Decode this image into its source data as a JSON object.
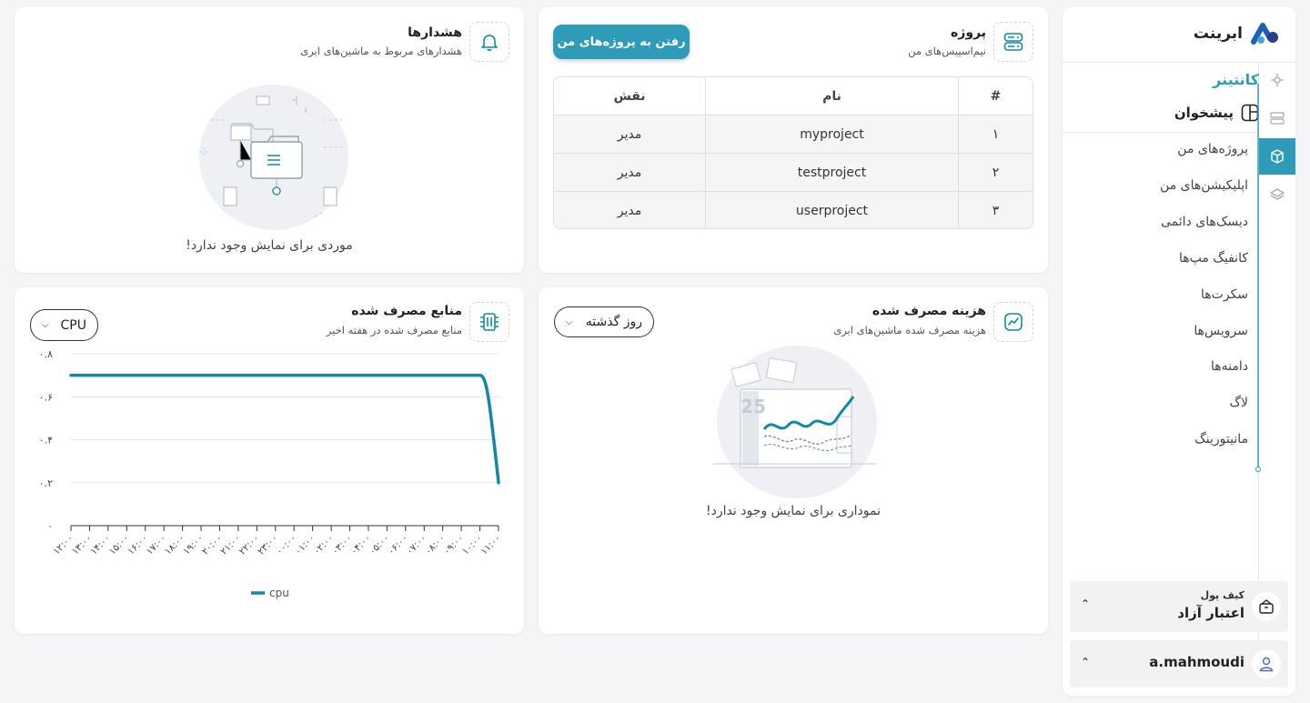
{
  "brand": {
    "name": "ابرینت"
  },
  "sidebar": {
    "section_title": "کانتینر",
    "dashboard_label": "پیشخوان",
    "items": [
      {
        "label": "پروژه‌های من"
      },
      {
        "label": "اپلیکیشن‌های من"
      },
      {
        "label": "دیسک‌های دائمی"
      },
      {
        "label": "کانفیگ مپ‌ها"
      },
      {
        "label": "سکرت‌ها"
      },
      {
        "label": "سرویس‌ها"
      },
      {
        "label": "دامنه‌ها"
      },
      {
        "label": "لاگ"
      },
      {
        "label": "مانیتورینگ"
      }
    ],
    "wallet": {
      "title": "کیف پول",
      "value": "اعتبار آزاد"
    },
    "user": {
      "name": "a.mahmoudi"
    },
    "accent": "#2e9bb8"
  },
  "projects": {
    "title": "پروژه",
    "subtitle": "نیم‌اسپیس‌های من",
    "button_label": "رفتن به پروژه‌های من",
    "columns": [
      "#",
      "نام",
      "نقش"
    ],
    "rows": [
      {
        "num": "۱",
        "name": "myproject",
        "role": "مدیر"
      },
      {
        "num": "۲",
        "name": "testproject",
        "role": "مدیر"
      },
      {
        "num": "۳",
        "name": "userproject",
        "role": "مدیر"
      }
    ]
  },
  "alerts": {
    "title": "هشدارها",
    "subtitle": "هشدارهای مربوط به ماشین‌های ابری",
    "empty_text": "موردی برای نمایش وجود ندارد!"
  },
  "cost": {
    "title": "هزینه مصرف شده",
    "subtitle": "هزینه مصرف شده ماشین‌های ابری",
    "dropdown": "روز گذشته",
    "illustration_number": "25",
    "empty_text": "نموداری برای نمایش وجود ندارد!"
  },
  "resources": {
    "title": "منابع مصرف شده",
    "subtitle": "منابع مصرف شده در هفته اخیر",
    "dropdown": "CPU"
  },
  "chart_data": {
    "type": "line",
    "y_ticks": [
      "۰",
      "۰.۲",
      "۰.۴",
      "۰.۶",
      "۰.۸"
    ],
    "ylim": [
      0,
      0.8
    ],
    "x_ticks": [
      "۱۲:۰۰",
      "۱۳:۰۰",
      "۱۴:۰۰",
      "۱۵:۰۰",
      "۱۶:۰۰",
      "۱۷:۰۰",
      "۱۸:۰۰",
      "۱۹:۰۰",
      "۲۰:۰۰",
      "۲۱:۰۰",
      "۲۲:۰۰",
      "۲۳:۰۰",
      "۰۰:۰۰",
      "۰۱:۰۰",
      "۰۲:۰۰",
      "۰۳:۰۰",
      "۰۴:۰۰",
      "۰۵:۰۰",
      "۰۶:۰۰",
      "۰۷:۰۰",
      "۰۸:۰۰",
      "۰۹:۰۰",
      "۱۰:۰۰",
      "۱۱:۰۰"
    ],
    "series": [
      {
        "name": "cpu",
        "color": "#1487a8",
        "values": [
          0.7,
          0.7,
          0.7,
          0.7,
          0.7,
          0.7,
          0.7,
          0.7,
          0.7,
          0.7,
          0.7,
          0.7,
          0.7,
          0.7,
          0.7,
          0.7,
          0.7,
          0.7,
          0.7,
          0.7,
          0.7,
          0.7,
          0.7,
          0.2
        ]
      }
    ],
    "grid": true,
    "legend": "bottom"
  }
}
